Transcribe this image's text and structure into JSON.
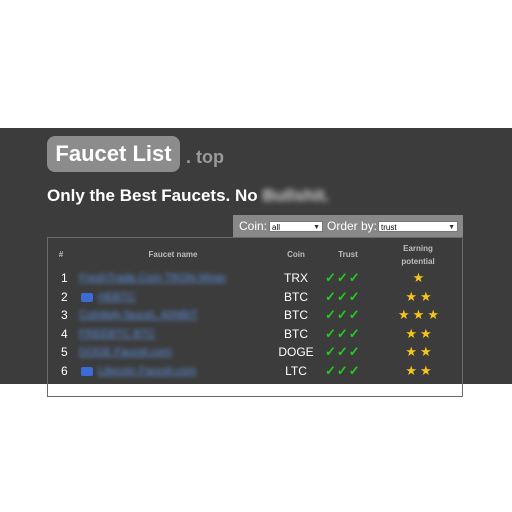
{
  "header": {
    "logo_text": "Faucet List",
    "logo_tld": ". top",
    "tagline_main": "Only the Best Faucets. No ",
    "tagline_blurred": "Bullshit."
  },
  "filters": {
    "coin_label": "Coin:",
    "coin_value": "all",
    "order_label": "Order by:",
    "order_value": "trust"
  },
  "table": {
    "headers": [
      "#",
      "Faucet name",
      "Coin",
      "Trust",
      "Earning\npotential"
    ],
    "rows": [
      {
        "num": "1",
        "name": "FreshTrade.Com TRON Miner",
        "coin": "TRX",
        "trust": "✓✓✓",
        "stars": "★",
        "icon": false
      },
      {
        "num": "2",
        "name": "HEBTC",
        "coin": "BTC",
        "trust": "✓✓✓",
        "stars": "★★",
        "icon": true
      },
      {
        "num": "3",
        "name": "Cointiply faucet, 40NBIT",
        "coin": "BTC",
        "trust": "✓✓✓",
        "stars": "★★★",
        "icon": false
      },
      {
        "num": "4",
        "name": "FREEBTC BTC",
        "coin": "BTC",
        "trust": "✓✓✓",
        "stars": "★★",
        "icon": false
      },
      {
        "num": "5",
        "name": "DOGE Faucet.com",
        "coin": "DOGE",
        "trust": "✓✓✓",
        "stars": "★★",
        "icon": false
      },
      {
        "num": "6",
        "name": "Litecoin Faucet.com",
        "coin": "LTC",
        "trust": "✓✓✓",
        "stars": "★★",
        "icon": true
      }
    ]
  },
  "colors": {
    "background": "#3c3c3c",
    "link": "#5b8cd6",
    "trust_check": "#22cc22",
    "star": "#f5c518"
  }
}
